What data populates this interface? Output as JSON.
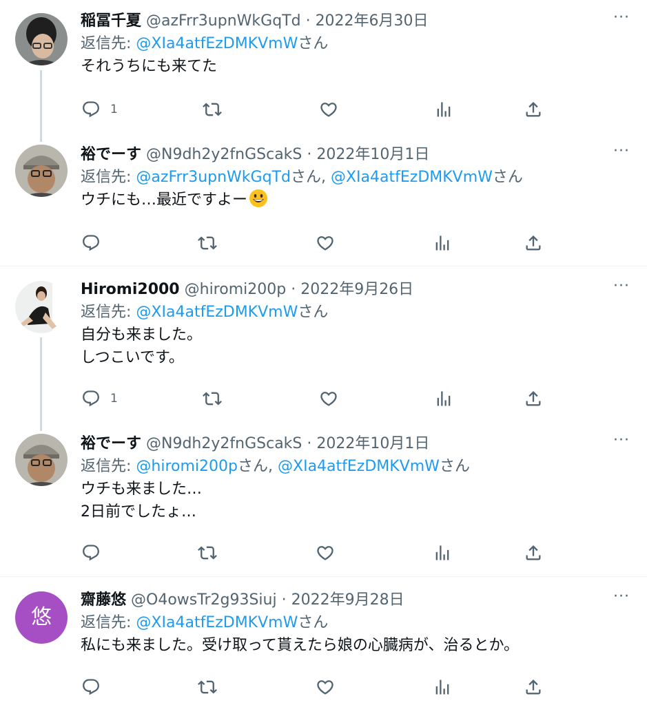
{
  "tweets": [
    {
      "name": "稲冨千夏",
      "handle": "@azFrr3upnWkGqTd",
      "date": "2022年6月30日",
      "reply_prefix": "返信先:",
      "mentions": [
        "@XIa4atfEzDMKVmW"
      ],
      "san": "さん",
      "lines": [
        "それうちにも来てた"
      ],
      "reply_count": "1"
    },
    {
      "name": "裕でーす",
      "handle": "@N9dh2y2fnGScakS",
      "date": "2022年10月1日",
      "reply_prefix": "返信先:",
      "mentions": [
        "@azFrr3upnWkGqTd",
        "@XIa4atfEzDMKVmW"
      ],
      "san": "さん",
      "lines": [
        "ウチにも…最近ですよー"
      ],
      "reply_count": ""
    },
    {
      "name": "Hiromi2000",
      "handle": "@hiromi200p",
      "date": "2022年9月26日",
      "reply_prefix": "返信先:",
      "mentions": [
        "@XIa4atfEzDMKVmW"
      ],
      "san": "さん",
      "lines": [
        "自分も来ました。",
        "しつこいです。"
      ],
      "reply_count": "1"
    },
    {
      "name": "裕でーす",
      "handle": "@N9dh2y2fnGScakS",
      "date": "2022年10月1日",
      "reply_prefix": "返信先:",
      "mentions": [
        "@hiromi200p",
        "@XIa4atfEzDMKVmW"
      ],
      "san": "さん",
      "lines": [
        "ウチも来ました…",
        "2日前でしたょ…"
      ],
      "reply_count": ""
    },
    {
      "name": "齋藤悠",
      "handle": "@O4owsTr2g93Siuj",
      "date": "2022年9月28日",
      "reply_prefix": "返信先:",
      "mentions": [
        "@XIa4atfEzDMKVmW"
      ],
      "san": "さん",
      "lines": [
        "私にも来ました。受け取って貰えたら娘の心臓病が、治るとか。"
      ],
      "reply_count": "",
      "avatar_letter": "悠"
    }
  ],
  "separator": "·",
  "more_glyph": "···",
  "colors": {
    "link": "#1d9bf0",
    "secondary": "#536471",
    "avatar_purple": "#a64ec3"
  },
  "icons": [
    "reply-icon",
    "retweet-icon",
    "like-icon",
    "views-icon",
    "share-icon",
    "grinning-face-emoji"
  ]
}
